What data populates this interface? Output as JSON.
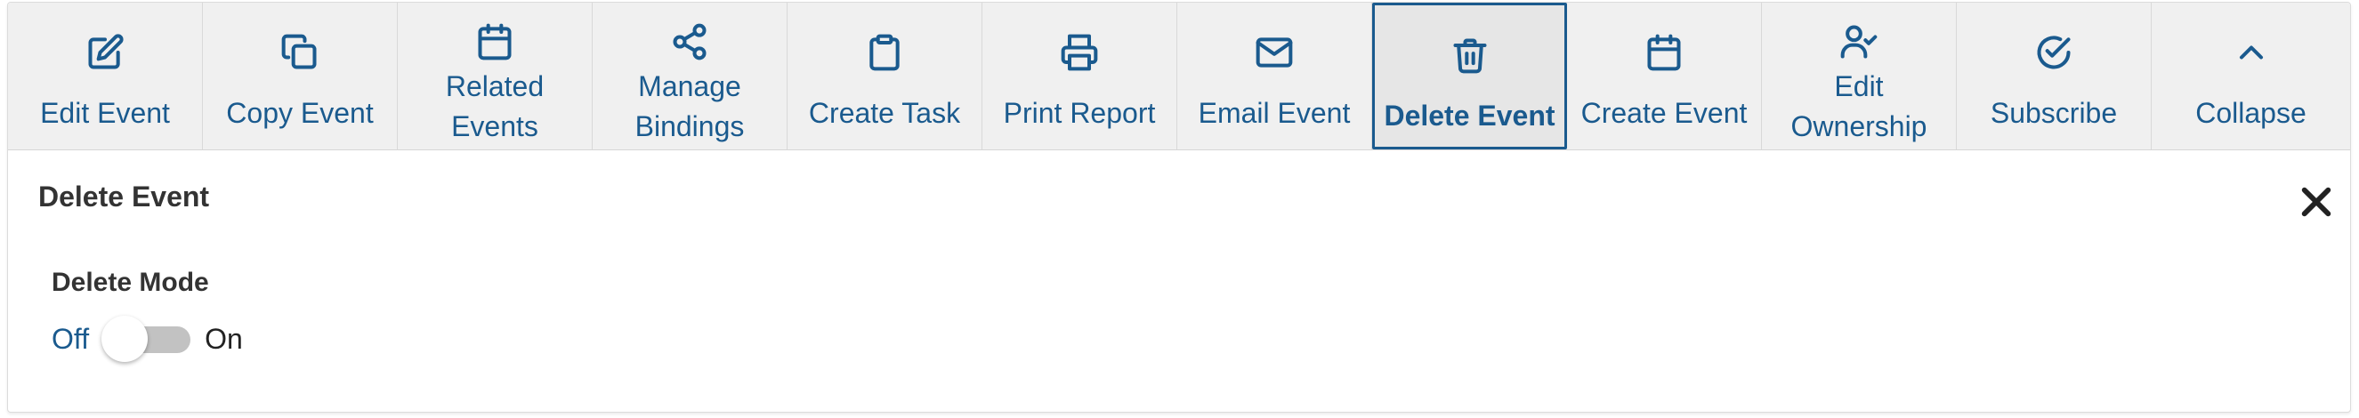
{
  "toolbar": {
    "buttons": [
      {
        "label": "Edit Event",
        "icon": "edit-icon"
      },
      {
        "label": "Copy Event",
        "icon": "copy-icon"
      },
      {
        "label_line1": "Related",
        "label_line2": "Events",
        "icon": "calendar-icon"
      },
      {
        "label_line1": "Manage",
        "label_line2": "Bindings",
        "icon": "share-icon"
      },
      {
        "label": "Create Task",
        "icon": "clipboard-icon"
      },
      {
        "label": "Print Report",
        "icon": "printer-icon"
      },
      {
        "label": "Email Event",
        "icon": "envelope-icon"
      },
      {
        "label": "Delete Event",
        "icon": "trash-icon",
        "active": true
      },
      {
        "label": "Create Event",
        "icon": "calendar-icon"
      },
      {
        "label_line1": "Edit",
        "label_line2": "Ownership",
        "icon": "user-check-icon"
      },
      {
        "label": "Subscribe",
        "icon": "check-circle-icon"
      },
      {
        "label": "Collapse",
        "icon": "chevron-up-icon"
      }
    ]
  },
  "panel": {
    "title": "Delete Event",
    "delete_mode": {
      "label": "Delete Mode",
      "off_label": "Off",
      "on_label": "On",
      "state": "off"
    }
  },
  "colors": {
    "accent": "#1a5a8e",
    "toolbar_bg": "#f0f0f0",
    "toggle_track": "#c2c2c2"
  }
}
